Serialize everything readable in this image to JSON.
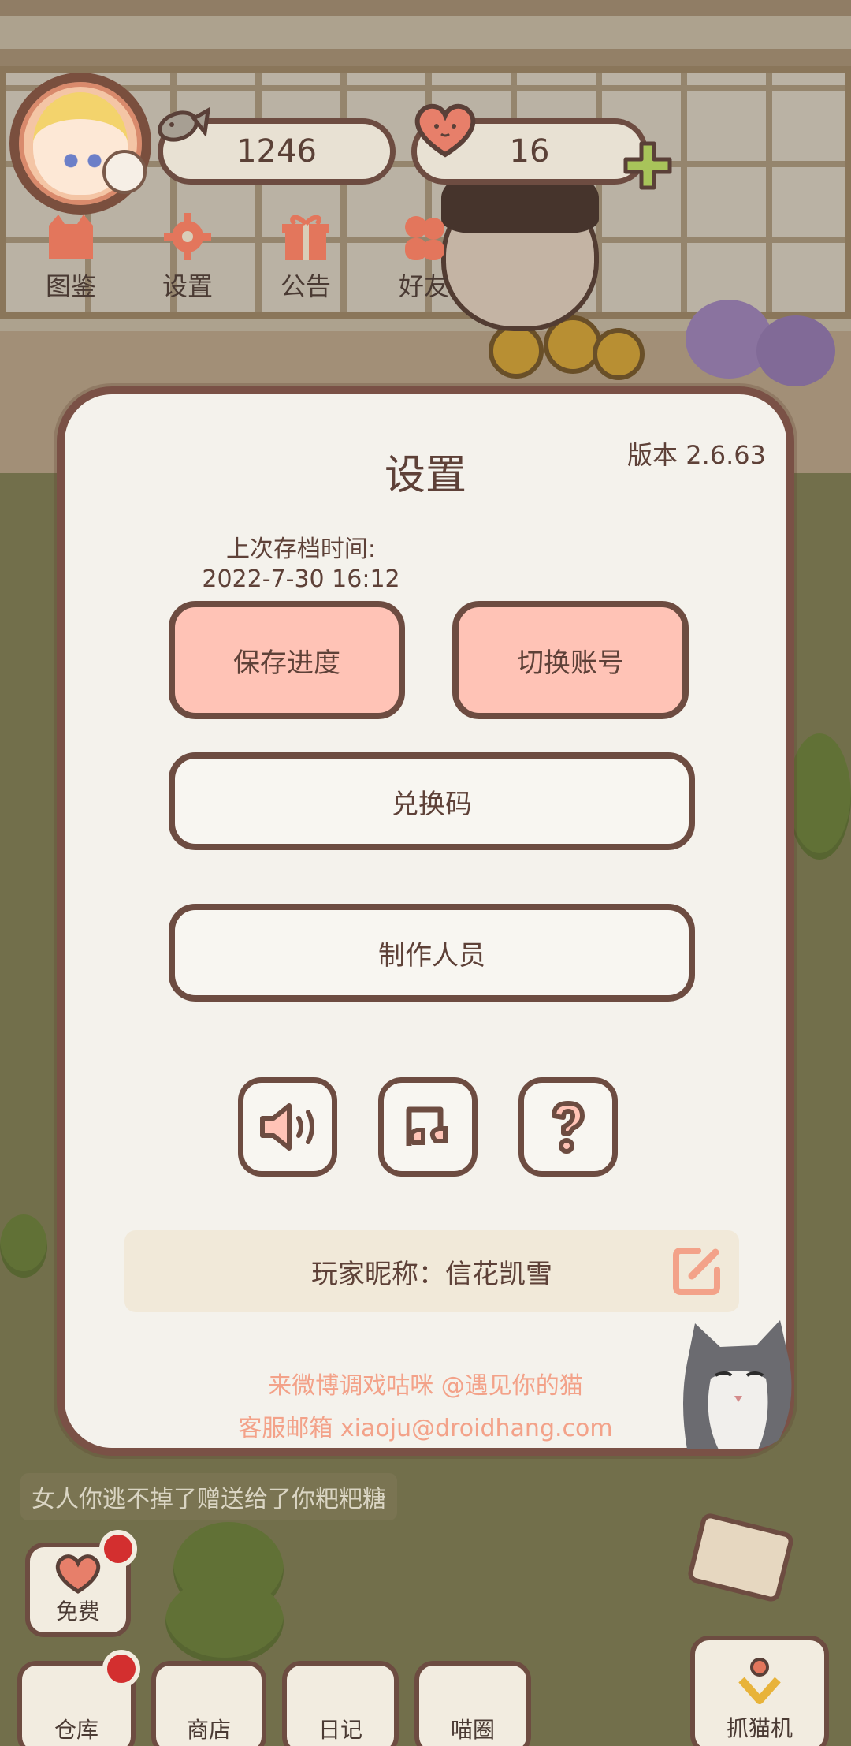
{
  "hud": {
    "fish_count": "1246",
    "heart_count": "16",
    "menu": [
      {
        "label": "图鉴",
        "icon": "cat-book-icon"
      },
      {
        "label": "设置",
        "icon": "gear-icon"
      },
      {
        "label": "公告",
        "icon": "gift-icon"
      },
      {
        "label": "好友",
        "icon": "friends-icon"
      }
    ]
  },
  "settings": {
    "title": "设置",
    "version": "版本 2.6.63",
    "save_time_label": "上次存档时间:",
    "save_time_value": "2022-7-30 16:12",
    "save_button": "保存进度",
    "switch_button": "切换账号",
    "redeem_button": "兑换码",
    "credits_button": "制作人员",
    "icon_buttons": [
      "speaker-icon",
      "music-icon",
      "help-icon"
    ],
    "nickname": "玩家昵称：信花凯雪",
    "weibo_line": "来微博调戏咕咪 @遇见你的猫",
    "email_line": "客服邮箱 xiaoju@droidhang.com"
  },
  "chat": {
    "line_visible": "女人你逃不掉了赠送给了你粑粑糖"
  },
  "bottom": {
    "free_label": "免费",
    "tabs": [
      "仓库",
      "商店",
      "日记",
      "喵圈"
    ],
    "claw_label": "抓猫机"
  },
  "colors": {
    "accent_pink": "#ffc3b6",
    "border_brown": "#6d4c41",
    "link_orange": "#f3a289",
    "panel_bg": "#f4f2ec"
  }
}
